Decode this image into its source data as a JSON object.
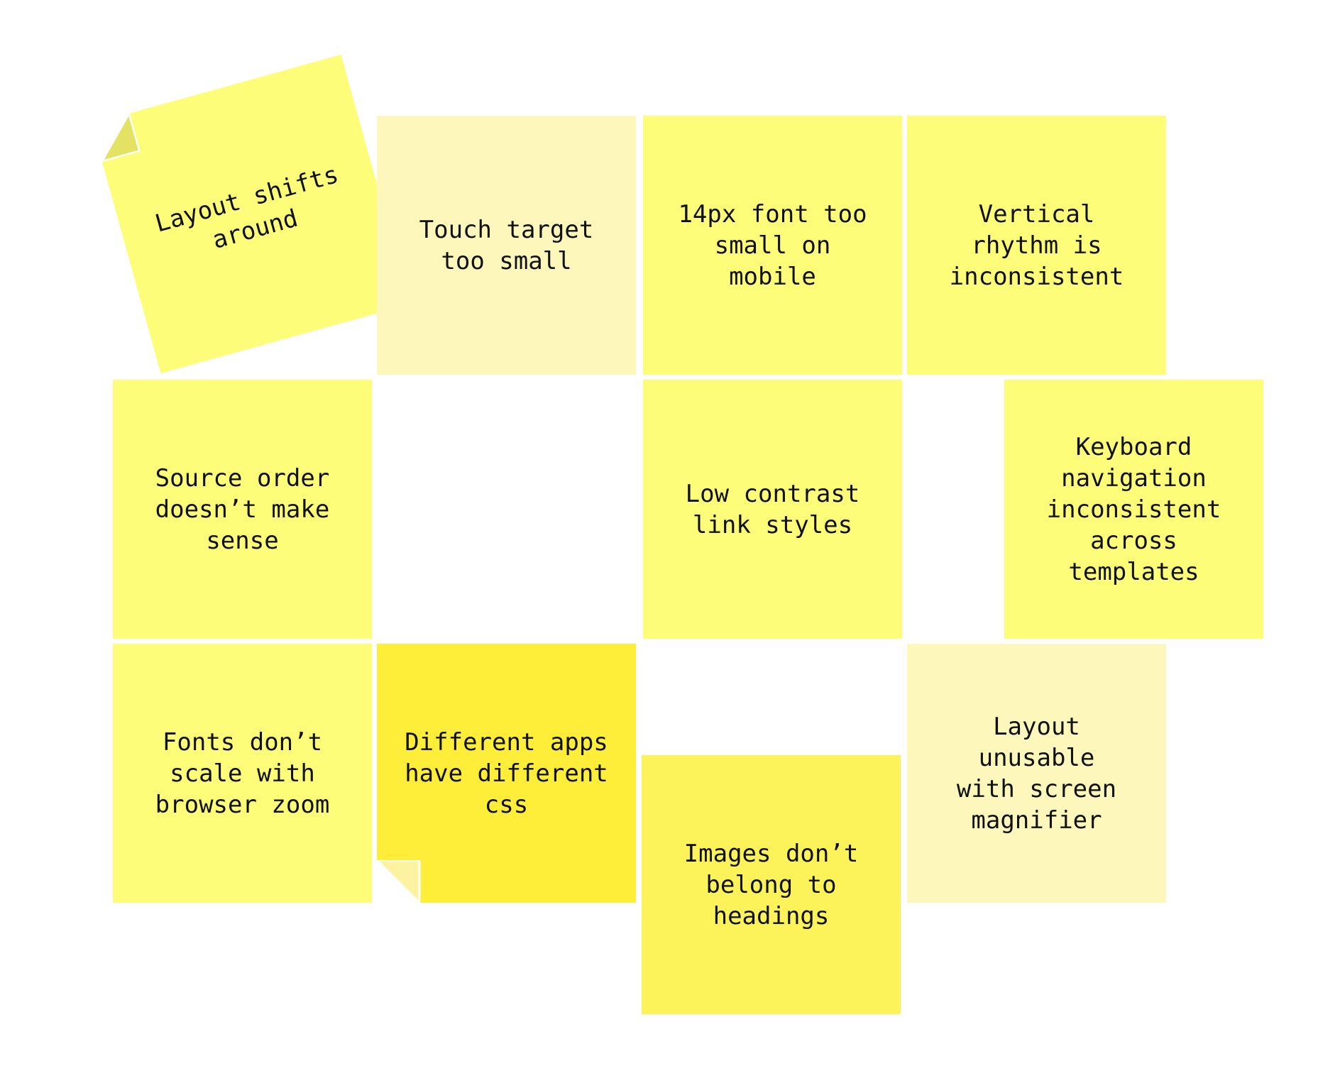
{
  "notes": [
    {
      "id": "layout-shifts",
      "text": "Layout shifts\naround",
      "color": "#fdfd7a",
      "rotated": true,
      "folded_corner": "top-left"
    },
    {
      "id": "touch-target",
      "text": "Touch target\ntoo small",
      "color": "#fdf7bc"
    },
    {
      "id": "font-mobile",
      "text": "14px font too\nsmall on mobile",
      "color": "#fdfd7a"
    },
    {
      "id": "vertical-rhythm",
      "text": "Vertical\nrhythm is\ninconsistent",
      "color": "#fdfd7a"
    },
    {
      "id": "source-order",
      "text": "Source order\ndoesn’t make\nsense",
      "color": "#fdfd7a"
    },
    {
      "id": "low-contrast",
      "text": "Low contrast\nlink styles",
      "color": "#fdfd7a"
    },
    {
      "id": "keyboard-nav",
      "text": "Keyboard\nnavigation\ninconsistent\nacross\ntemplates",
      "color": "#fdfd7a"
    },
    {
      "id": "fonts-zoom",
      "text": "Fonts don’t\nscale with\nbrowser zoom",
      "color": "#fdfd7a"
    },
    {
      "id": "different-css",
      "text": "Different apps\nhave different\ncss",
      "color": "#feee3a",
      "folded_corner": "bottom-left"
    },
    {
      "id": "images-headings",
      "text": "Images don’t\nbelong to\nheadings",
      "color": "#fcf35a"
    },
    {
      "id": "screen-magnifier",
      "text": "Layout\nunusable\nwith screen\nmagnifier",
      "color": "#fdf7bc"
    }
  ]
}
